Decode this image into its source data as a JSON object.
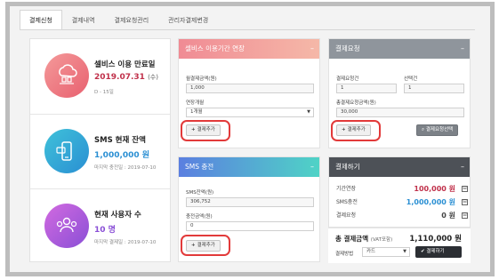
{
  "tabs": [
    "결제신청",
    "결제내역",
    "결제요청관리",
    "관리자결제변경"
  ],
  "left": {
    "service": {
      "title": "셀비스 이용 만료일",
      "value_date": "2019.07.31",
      "value_day": "(수)",
      "sub": "D - 15일"
    },
    "sms": {
      "title": "SMS 현재 잔액",
      "value": "1,000,000 원",
      "sub": "마지막 충전일 : 2019-07-10"
    },
    "users": {
      "title": "현재 사용자 수",
      "value": "10 명",
      "sub": "마지막 결제일 : 2019-07-10"
    }
  },
  "extend": {
    "title": "셀비스 이용기간 연장",
    "monthly_label": "월결제금액(원)",
    "monthly_value": "1,000",
    "period_label": "연장개월",
    "period_value": "1개월",
    "add_btn": "결제추가"
  },
  "sms_charge": {
    "title": "SMS 충전",
    "balance_label": "SMS잔액(원)",
    "balance_value": "306,752",
    "charge_label": "충전금액(원)",
    "charge_value": "0",
    "add_btn": "결제추가"
  },
  "request": {
    "title": "결제요청",
    "count_label": "결제요청건",
    "count_value": "1",
    "select_label": "선택건",
    "select_value": "1",
    "total_label": "총결제요청금액(원)",
    "total_value": "30,000",
    "add_btn": "결제추가",
    "select_btn": "결제요청선택"
  },
  "checkout": {
    "title": "결제하기",
    "rows": [
      {
        "label": "기간연장",
        "amount": "100,000 원",
        "box": "⊟"
      },
      {
        "label": "SMS충전",
        "amount": "1,000,000 원",
        "box": "⊟"
      },
      {
        "label": "결제요청",
        "amount": "0 원",
        "box": "⊟"
      }
    ],
    "total_label": "총 결제금액",
    "total_sub": "(VAT포함)",
    "total_value": "1,110,000 원",
    "method_label": "결제방법",
    "method_value": "카드",
    "pay_btn": "결제하기"
  },
  "colors": {
    "accent_red": "#c0304a",
    "accent_blue": "#2a8fd3",
    "accent_purple": "#8a4fd6",
    "highlight_ring": "#e23a3a"
  }
}
